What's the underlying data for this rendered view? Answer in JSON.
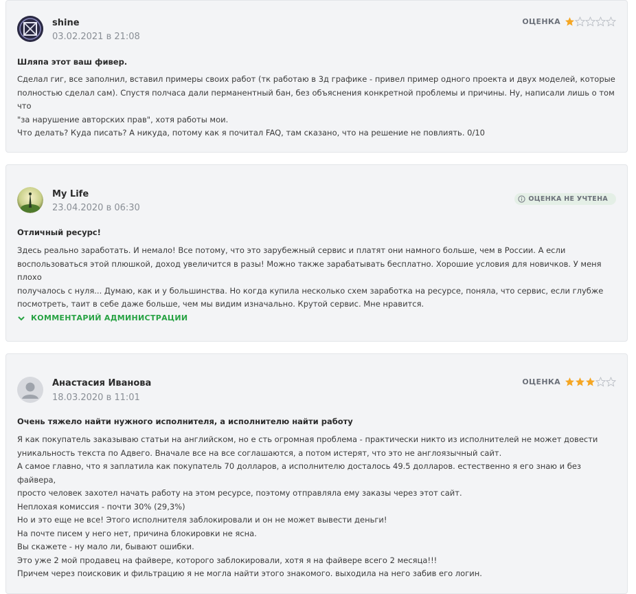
{
  "reviews": [
    {
      "author": "shine",
      "date": "03.02.2021 в 21:08",
      "rating_label": "ОЦЕНКА",
      "rating": 1,
      "max_rating": 5,
      "title": "Шляпа этот ваш фивер.",
      "lines": [
        "Сделал гиг, все заполнил, вставил примеры своих работ (тк работаю в 3д графике - привел пример одного проекта и двух моделей, которые",
        "полностью сделал сам). Спустя полчаса дали перманентный бан, без объяснения конкретной проблемы и причины. Ну, написали лишь о том что",
        "\"за нарушение авторских прав\", хотя работы мои.",
        "Что делать? Куда писать? А никуда, потому как я почитал FAQ, там сказано, что на решение не повлиять. 0/10"
      ]
    },
    {
      "author": "My Life",
      "date": "23.04.2020 в 06:30",
      "badge": "ОЦЕНКА НЕ УЧТЕНА",
      "title": "Отличный ресурс!",
      "lines": [
        "Здесь реально заработать. И немало! Все потому, что это зарубежный сервис и платят они намного больше, чем в России. А если",
        "воспользоваться этой плюшкой, доход увеличится в разы! Можно также зарабатывать бесплатно. Хорошие условия для новичков. У меня плохо",
        "получалось с нуля... Думаю, как и у большинства. Но когда купила несколько схем заработка на ресурсе, поняла, что сервис, если глубже",
        "посмотреть, таит в себе даже больше, чем мы видим изначально. Крутой сервис. Мне нравится."
      ],
      "admin_comment_label": "КОММЕНТАРИЙ АДМИНИСТРАЦИИ"
    },
    {
      "author": "Анастасия Иванова",
      "date": "18.03.2020 в 11:01",
      "rating_label": "ОЦЕНКА",
      "rating": 3,
      "max_rating": 5,
      "title": "Очень тяжело найти нужного исполнителя, а исполнителю найти работу",
      "lines": [
        "Я как покупатель заказываю статьи на английском, но е сть огромная проблема - практически никто из исполнителей не может довести",
        "уникальность текста по Адвего. Вначале все на все соглашаются, а потом истерят, что это не англоязычный сайт.",
        "А самое главно, что я заплатила как покупатель 70 долларов, а исполнителю досталось 49.5 долларов. естественно я его знаю и без файвера,",
        "просто человек захотел начать работу на этом ресурсе, поэтому отправляла ему заказы через этот сайт.",
        "Неплохая комиссия - почти 30% (29,3%)",
        "Но и это еще не все! Этого исполнителя заблокировали и он не может вывести деньги!",
        "На почте писем у него нет, причина блокировки не ясна.",
        "Вы скажете - ну мало ли, бывают ошибки.",
        "Это уже 2 мой продавец на файвере, которого заблокировали, хотя я на файвере всего 2 месяца!!!",
        "Причем через поисковик и фильтрацию я не могла найти этого знакомого. выходила на него забив его логин."
      ]
    }
  ],
  "colors": {
    "star": "#f5a623",
    "accent_green": "#27a243",
    "muted": "#8a8f96"
  },
  "icons": {
    "star": "star-icon",
    "info": "info-icon",
    "chevron": "chevron-down-icon"
  }
}
